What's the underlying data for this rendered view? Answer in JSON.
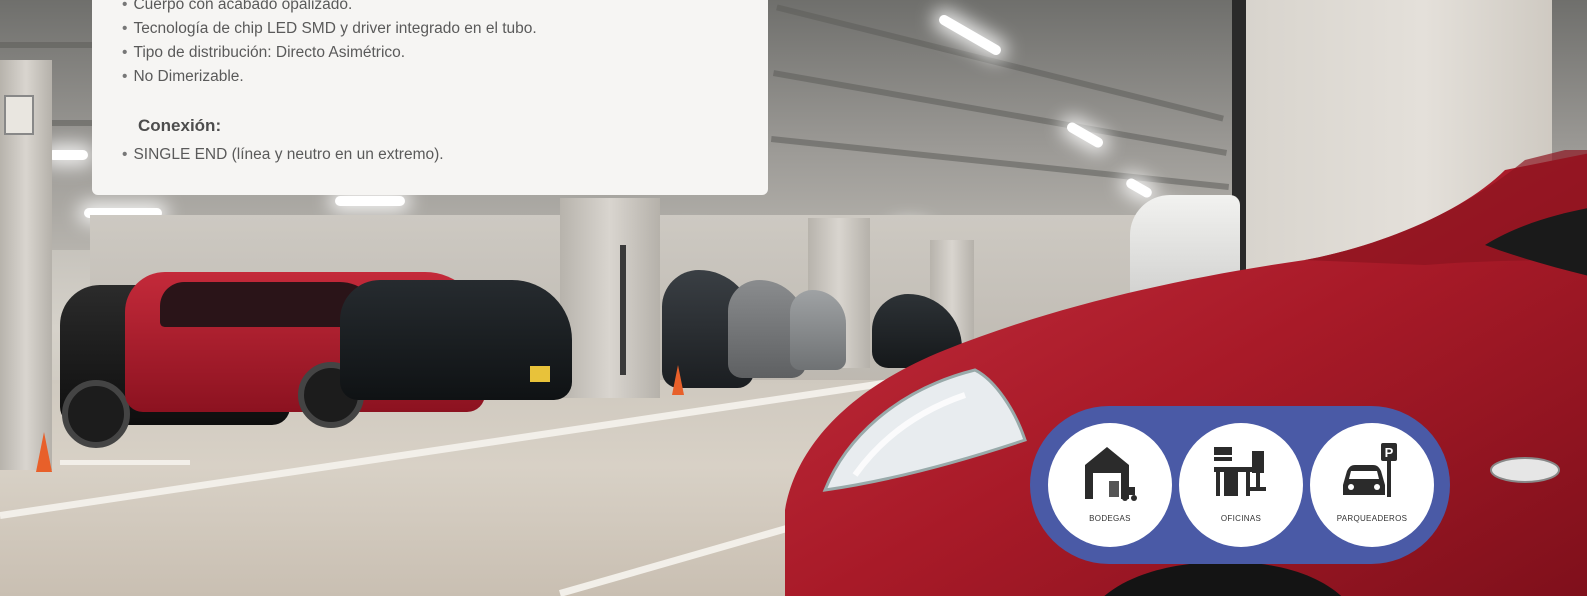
{
  "specs": {
    "items": [
      "Cuerpo con acabado opalizado.",
      "Tecnología de chip LED SMD y driver integrado en el tubo.",
      "Tipo de distribución: Directo Asimétrico.",
      "No Dimerizable."
    ]
  },
  "connection": {
    "title": "Conexión:",
    "items": [
      "SINGLE END (línea y neutro en un extremo)."
    ]
  },
  "applications": [
    {
      "label": "BODEGAS",
      "icon": "warehouse-icon"
    },
    {
      "label": "OFICINAS",
      "icon": "office-desk-icon"
    },
    {
      "label": "PARQUEADEROS",
      "icon": "parking-car-icon"
    }
  ],
  "colors": {
    "badge": "#4a5aa6",
    "car_red": "#b01f2c",
    "card_background": "#f6f5f3"
  }
}
